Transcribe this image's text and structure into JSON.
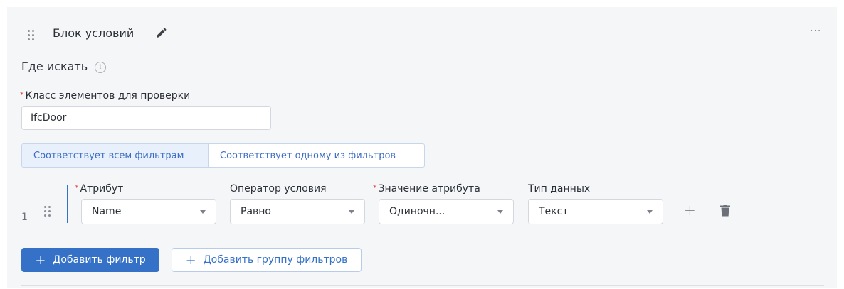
{
  "block": {
    "title": "Блок условий",
    "more_label": "···"
  },
  "where": {
    "label": "Где искать",
    "info_glyph": "i"
  },
  "element_class": {
    "required_mark": "*",
    "label": "Класс элементов для проверки",
    "value": "IfcDoor"
  },
  "match_mode": {
    "options": [
      "Соответствует всем фильтрам",
      "Соответствует одному из фильтров"
    ],
    "selected_index": 0
  },
  "filter_row": {
    "index": "1",
    "attribute": {
      "required_mark": "*",
      "label": "Атрибут",
      "value": "Name"
    },
    "operator": {
      "label": "Оператор условия",
      "value": "Равно"
    },
    "attr_value": {
      "required_mark": "*",
      "label": "Значение атрибута",
      "value": "Одиночн..."
    },
    "data_type": {
      "label": "Тип данных",
      "value": "Текст"
    },
    "add_glyph": "+"
  },
  "actions": {
    "add_filter": "Добавить фильтр",
    "add_group": "Добавить группу фильтров",
    "plus_glyph": "+"
  },
  "colors": {
    "accent": "#3471c7",
    "required": "#e5484d",
    "card_bg": "#f5f6f8"
  }
}
